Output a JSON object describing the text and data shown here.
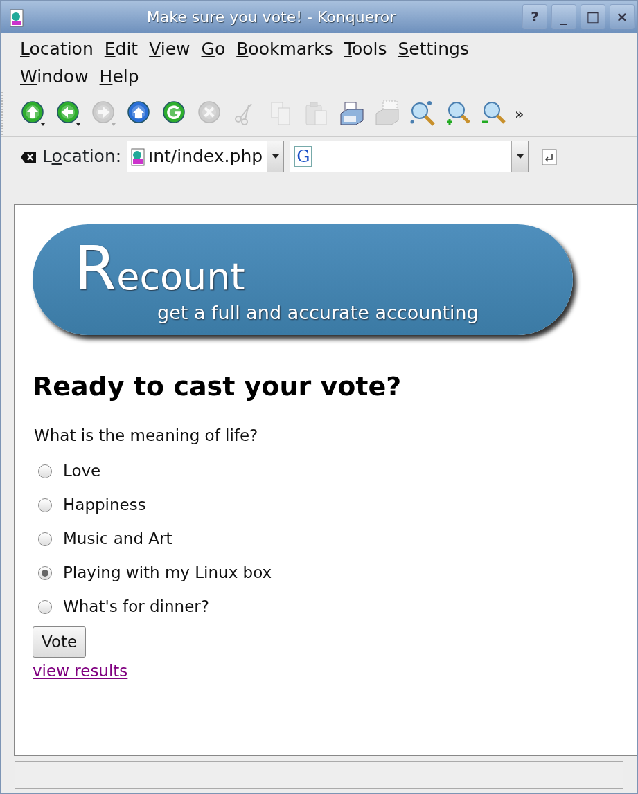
{
  "window": {
    "title": "Make sure you vote! - Konqueror",
    "buttons": [
      "?",
      "_",
      "□",
      "×"
    ]
  },
  "menu": [
    "Location",
    "Edit",
    "View",
    "Go",
    "Bookmarks",
    "Tools",
    "Settings",
    "Window",
    "Help"
  ],
  "toolbar": [
    {
      "kind": "up",
      "disabled": false
    },
    {
      "kind": "back",
      "disabled": false
    },
    {
      "kind": "forward",
      "disabled": true
    },
    {
      "kind": "home",
      "disabled": false
    },
    {
      "kind": "reload",
      "disabled": false
    },
    {
      "kind": "stop",
      "disabled": true
    },
    {
      "kind": "cut",
      "disabled": true
    },
    {
      "kind": "copy",
      "disabled": true
    },
    {
      "kind": "paste",
      "disabled": true
    },
    {
      "kind": "print",
      "disabled": false
    },
    {
      "kind": "preview",
      "disabled": true
    },
    {
      "kind": "find",
      "disabled": false
    },
    {
      "kind": "zoomin",
      "disabled": false
    },
    {
      "kind": "zoomout",
      "disabled": false
    }
  ],
  "toolbar_more": "»",
  "location_bar": {
    "label": "Location:",
    "url": "ınt/index.php",
    "search_prefix": "G"
  },
  "page": {
    "logo": {
      "title": "Recount",
      "tagline": "get a full and accurate accounting"
    },
    "heading": "Ready to cast your vote?",
    "question": "What is the meaning of life?",
    "options": [
      {
        "label": "Love",
        "selected": false
      },
      {
        "label": "Happiness",
        "selected": false
      },
      {
        "label": "Music and Art",
        "selected": false
      },
      {
        "label": "Playing with my Linux box",
        "selected": true
      },
      {
        "label": "What's for dinner?",
        "selected": false
      }
    ],
    "submit": "Vote",
    "link": "view results"
  }
}
